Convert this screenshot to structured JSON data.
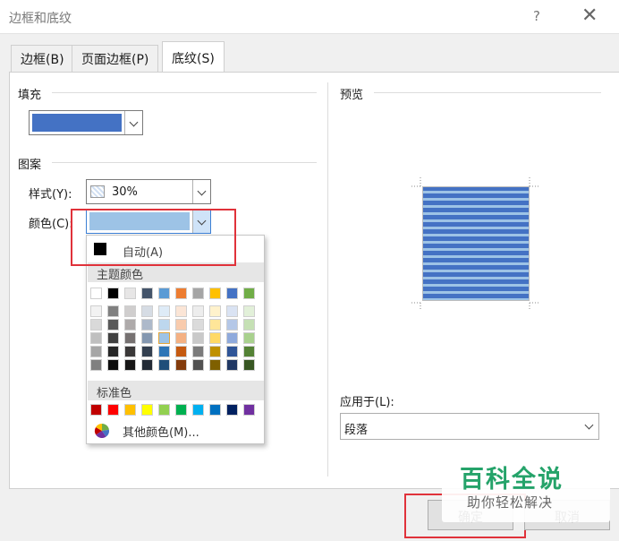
{
  "window": {
    "title": "边框和底纹",
    "help": "?",
    "close": "✕"
  },
  "tabs": [
    {
      "label": "边框(B)"
    },
    {
      "label": "页面边框(P)"
    },
    {
      "label": "底纹(S)"
    }
  ],
  "fill": {
    "label": "填充",
    "color": "#4472c4"
  },
  "pattern": {
    "label": "图案",
    "style_label": "样式(Y):",
    "style_value": "30%",
    "color_label": "颜色(C):",
    "color_value": "#9dc3e6"
  },
  "color_popup": {
    "auto_label": "自动(A)",
    "theme_header": "主题颜色",
    "theme_colors": [
      "#ffffff",
      "#000000",
      "#e7e6e6",
      "#44546a",
      "#5b9bd5",
      "#ed7d31",
      "#a5a5a5",
      "#ffc000",
      "#4472c4",
      "#70ad47"
    ],
    "theme_tints": [
      [
        "#f2f2f2",
        "#d9d9d9",
        "#bfbfbf",
        "#a6a6a6",
        "#808080"
      ],
      [
        "#808080",
        "#595959",
        "#404040",
        "#262626",
        "#0d0d0d"
      ],
      [
        "#d0cece",
        "#aeaaaa",
        "#767171",
        "#3a3838",
        "#171616"
      ],
      [
        "#d6dce4",
        "#adb9ca",
        "#8497b0",
        "#333f4f",
        "#222a35"
      ],
      [
        "#deebf7",
        "#bdd7ee",
        "#9dc3e6",
        "#2e75b6",
        "#1f4e79"
      ],
      [
        "#fbe5d6",
        "#f8cbad",
        "#f4b183",
        "#c55a11",
        "#843c0c"
      ],
      [
        "#ededed",
        "#dbdbdb",
        "#c9c9c9",
        "#7b7b7b",
        "#525252"
      ],
      [
        "#fff2cc",
        "#ffe699",
        "#ffd966",
        "#bf9000",
        "#7f6000"
      ],
      [
        "#dae3f3",
        "#b4c7e7",
        "#8faadc",
        "#2f5597",
        "#203864"
      ],
      [
        "#e2f0d9",
        "#c5e0b4",
        "#a9d18e",
        "#548235",
        "#385723"
      ]
    ],
    "standard_header": "标准色",
    "standard_colors": [
      "#c00000",
      "#ff0000",
      "#ffc000",
      "#ffff00",
      "#92d050",
      "#00b050",
      "#00b0f0",
      "#0070c0",
      "#002060",
      "#7030a0"
    ],
    "more_label": "其他颜色(M)..."
  },
  "preview": {
    "label": "预览",
    "fill_color": "#4472c4",
    "pattern_color": "#9dc3e6"
  },
  "apply": {
    "label": "应用于(L):",
    "value": "段落"
  },
  "buttons": {
    "ok": "确定",
    "cancel": "取消"
  },
  "watermark": {
    "main": "百科全说",
    "sub": "助你轻松解决"
  },
  "highlight_color": "#e0323a"
}
